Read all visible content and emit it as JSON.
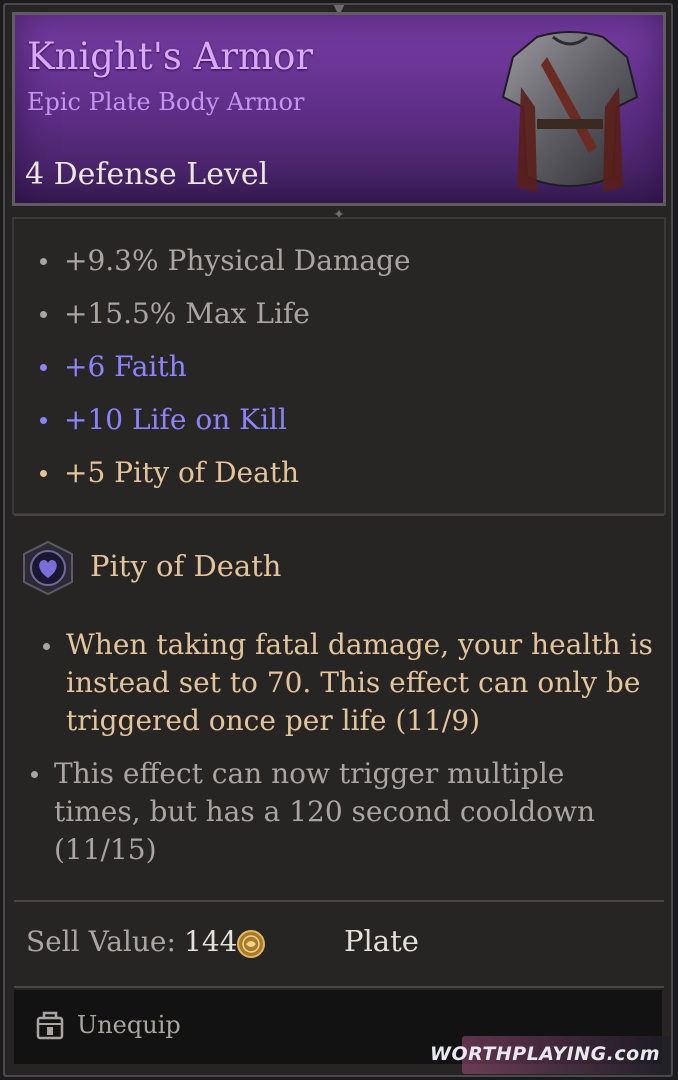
{
  "item": {
    "name": "Knight's Armor",
    "subtitle": "Epic Plate Body Armor",
    "defense": "4 Defense Level"
  },
  "stats": [
    {
      "text": "+9.3% Physical Damage",
      "color": "#a9a6a2"
    },
    {
      "text": "+15.5% Max Life",
      "color": "#a9a6a2"
    },
    {
      "text": "+6 Faith",
      "color": "#8b84ff"
    },
    {
      "text": "+10 Life on Kill",
      "color": "#8b84ff"
    },
    {
      "text": "+5 Pity of Death",
      "color": "#e4c49a"
    }
  ],
  "skill": {
    "name": "Pity of Death",
    "icon": "heart-shield-icon",
    "descriptions": [
      {
        "lines": [
          "When taking fatal damage, your health is",
          "instead set to 70. This effect can only be",
          "triggered once per life (11/9)"
        ],
        "color": "#e4c49a"
      },
      {
        "lines": [
          "This effect can now trigger multiple",
          "times, but has a 120 second cooldown",
          "(11/15)"
        ],
        "color": "#a9a6a2"
      }
    ]
  },
  "footer": {
    "sell_label": "Sell Value:",
    "sell_value": "144",
    "coin_icon": "gold-coin-icon",
    "type": "Plate"
  },
  "actions": {
    "unequip": "Unequip",
    "unequip_icon": "unequip-icon"
  },
  "watermark": "WORTHPLAYING.com"
}
